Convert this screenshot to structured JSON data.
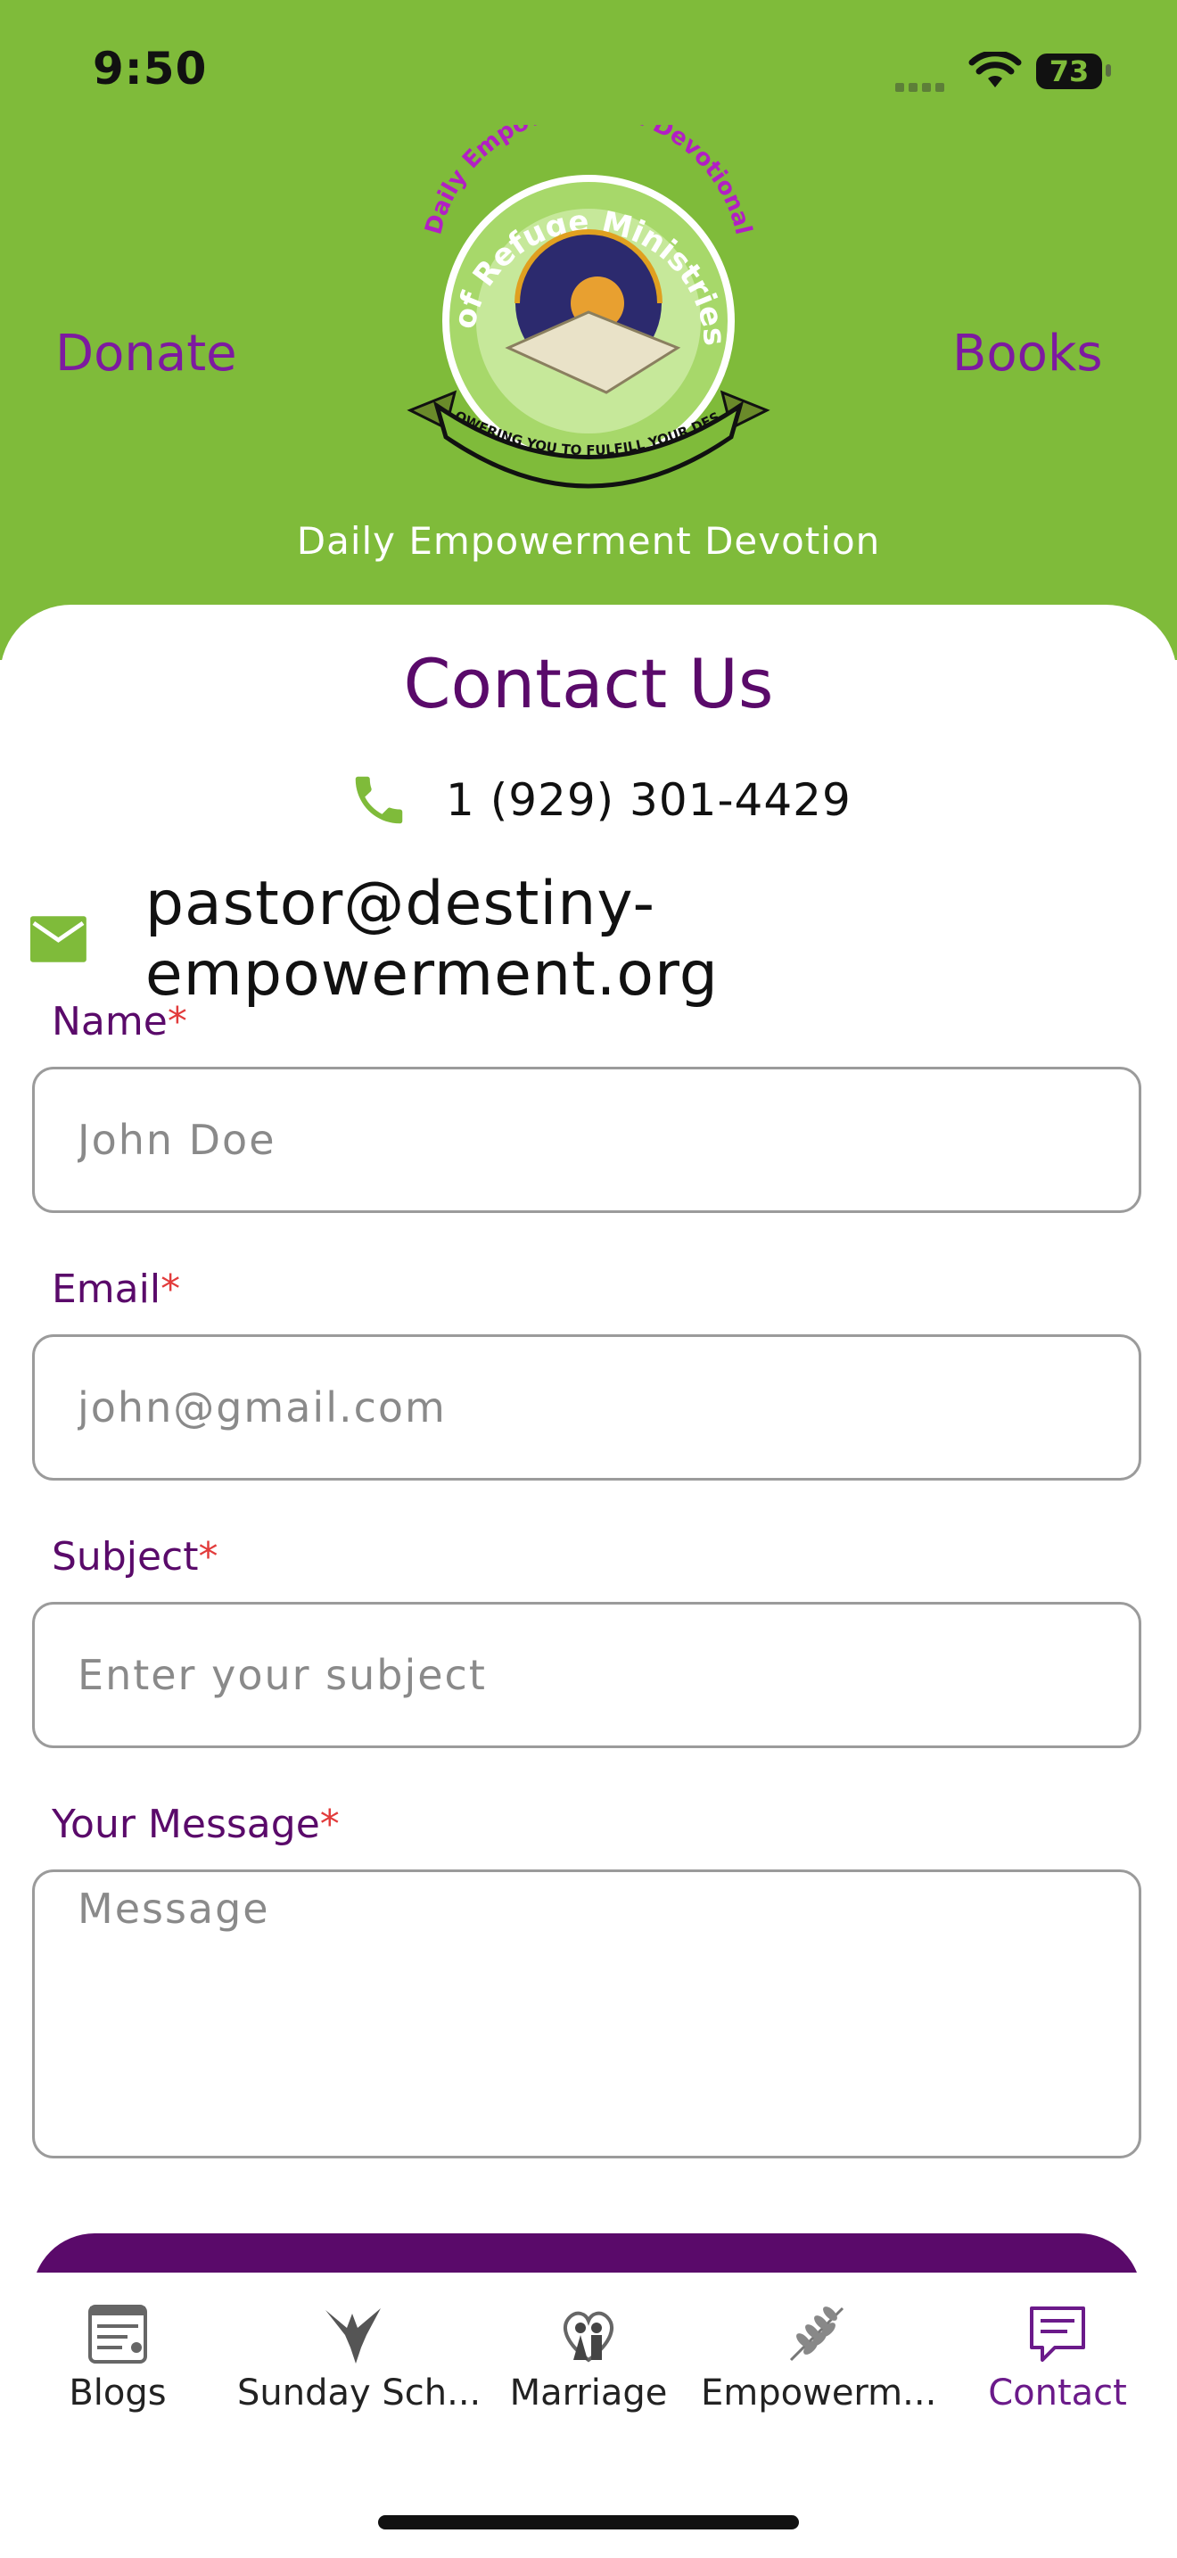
{
  "status_bar": {
    "time": "9:50",
    "battery": "73"
  },
  "header": {
    "donate_label": "Donate",
    "books_label": "Books",
    "subtitle": "Daily Empowerment Devotion",
    "logo": {
      "arc_text": "Daily Empowerment Devotional",
      "ring_text": "City of Refuge Ministries Inc",
      "banner_text": "EMPOWERING YOU TO FULFILL YOUR DESTINY"
    }
  },
  "contact": {
    "title": "Contact Us",
    "phone": "1 (929) 301-4429",
    "email": "pastor@destiny-empowerment.org"
  },
  "form": {
    "name": {
      "label": "Name",
      "required_mark": "*",
      "placeholder": "John Doe"
    },
    "email": {
      "label": "Email",
      "required_mark": "*",
      "placeholder": "john@gmail.com"
    },
    "subject": {
      "label": "Subject",
      "required_mark": "*",
      "placeholder": "Enter your subject"
    },
    "message": {
      "label": "Your Message",
      "required_mark": "*",
      "placeholder": "Message"
    }
  },
  "tabs": [
    {
      "label": "Blogs",
      "icon": "blog-icon",
      "active": false
    },
    {
      "label": "Sunday Sch...",
      "icon": "eagle-icon",
      "active": false
    },
    {
      "label": "Marriage",
      "icon": "couple-heart-icon",
      "active": false
    },
    {
      "label": "Empowerm...",
      "icon": "leaf-branch-icon",
      "active": false
    },
    {
      "label": "Contact",
      "icon": "chat-message-icon",
      "active": true
    }
  ],
  "colors": {
    "header_green": "#7fbb3a",
    "brand_purple": "#5a0a6a",
    "nav_purple": "#7d1aa0",
    "required_red": "#e23b3b"
  }
}
